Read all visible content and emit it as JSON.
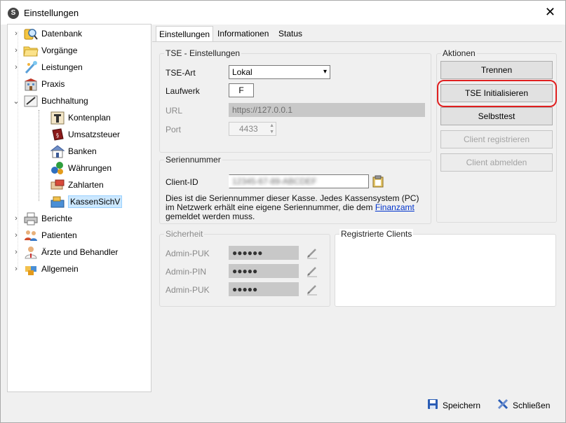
{
  "window": {
    "title": "Einstellungen",
    "close_glyph": "✕"
  },
  "tree": {
    "items": [
      {
        "label": "Datenbank",
        "icon": "database-search-icon"
      },
      {
        "label": "Vorgänge",
        "icon": "folder-icon"
      },
      {
        "label": "Leistungen",
        "icon": "wand-icon"
      },
      {
        "label": "Praxis",
        "icon": "building-icon"
      },
      {
        "label": "Buchhaltung",
        "icon": "ledger-icon"
      },
      {
        "label": "Kontenplan",
        "icon": "account-plan-icon"
      },
      {
        "label": "Umsatzsteuer",
        "icon": "book-icon"
      },
      {
        "label": "Banken",
        "icon": "bank-icon"
      },
      {
        "label": "Währungen",
        "icon": "currency-icon"
      },
      {
        "label": "Zahlarten",
        "icon": "payment-icon"
      },
      {
        "label": "KassenSichV",
        "icon": "cash-register-icon"
      },
      {
        "label": "Berichte",
        "icon": "printer-icon"
      },
      {
        "label": "Patienten",
        "icon": "patients-icon"
      },
      {
        "label": "Ärzte und Behandler",
        "icon": "doctor-icon"
      },
      {
        "label": "Allgemein",
        "icon": "puzzle-icon"
      }
    ]
  },
  "tabs": [
    "Einstellungen",
    "Informationen",
    "Status"
  ],
  "tse": {
    "group_title": "TSE - Einstellungen",
    "art_label": "TSE-Art",
    "art_value": "Lokal",
    "laufwerk_label": "Laufwerk",
    "laufwerk_value": "F",
    "url_label": "URL",
    "url_value": "https://127.0.0.1",
    "port_label": "Port",
    "port_value": "4433"
  },
  "serial": {
    "group_title": "Seriennummer",
    "client_id_label": "Client-ID",
    "client_id_value": "12345-67-89-ABCDEF",
    "desc_part1": "Dies ist die Seriennummer dieser Kasse. Jedes Kassensystem (PC) im Netzwerk erhält eine eigene Seriennummer, die dem ",
    "desc_link": "Finanzamt",
    "desc_part2": " gemeldet werden muss."
  },
  "actions": {
    "group_title": "Aktionen",
    "trennen": "Trennen",
    "init": "TSE Initialisieren",
    "selbsttest": "Selbsttest",
    "register": "Client registrieren",
    "unregister": "Client abmelden"
  },
  "security": {
    "group_title": "Sicherheit",
    "rows": [
      {
        "label": "Admin-PUK",
        "value": "●●●●●●"
      },
      {
        "label": "Admin-PIN",
        "value": "●●●●●"
      },
      {
        "label": "Admin-PUK",
        "value": "●●●●●"
      }
    ]
  },
  "clients": {
    "group_title": "Registrierte Clients"
  },
  "footer": {
    "save": "Speichern",
    "close": "Schließen"
  },
  "colors": {
    "highlight": "#e02020",
    "selection": "#cce8ff",
    "link": "#0033cc"
  }
}
